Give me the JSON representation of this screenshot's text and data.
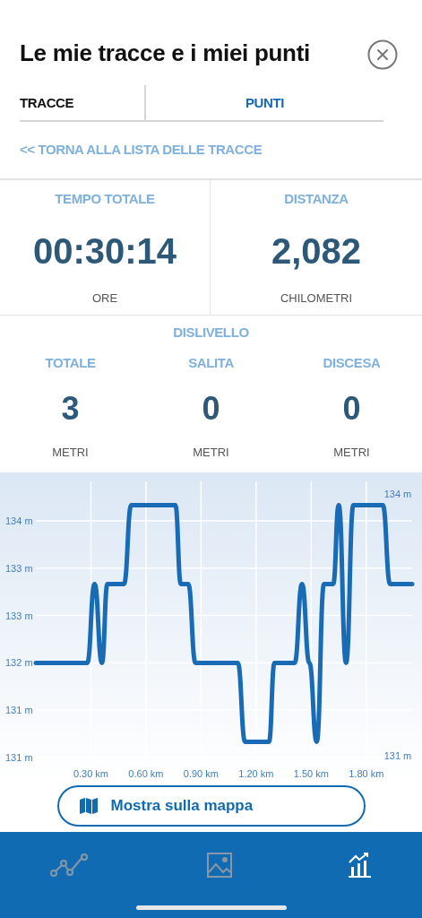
{
  "title": "Le mie tracce e i miei punti",
  "tabs": [
    {
      "label": "TRACCE",
      "selected": true
    },
    {
      "label": "PUNTI",
      "selected": false
    }
  ],
  "back_link": "<< TORNA ALLA LISTA DELLE TRACCE",
  "summary": [
    {
      "label": "TEMPO TOTALE",
      "value": "00:30:14",
      "unit": "ORE"
    },
    {
      "label": "DISTANZA",
      "value": "2,082",
      "unit": "CHILOMETRI"
    }
  ],
  "elevation": {
    "title": "DISLIVELLO",
    "stats": [
      {
        "label": "TOTALE",
        "value": "3",
        "unit": "METRI"
      },
      {
        "label": "SALITA",
        "value": "0",
        "unit": "METRI"
      },
      {
        "label": "DISCESA",
        "value": "0",
        "unit": "METRI"
      }
    ]
  },
  "chart_data": {
    "type": "line",
    "grid": true,
    "xlim": [
      0,
      2.05
    ],
    "ylim": [
      130.8,
      134.3
    ],
    "x": [
      0,
      0.28,
      0.32,
      0.36,
      0.39,
      0.48,
      0.52,
      0.76,
      0.79,
      0.83,
      0.87,
      1.1,
      1.14,
      1.27,
      1.3,
      1.41,
      1.45,
      1.49,
      1.53,
      1.57,
      1.62,
      1.65,
      1.69,
      1.73,
      1.89,
      1.93,
      2.05
    ],
    "series": [
      {
        "color": "#1a6bb5",
        "values": [
          132.0,
          132.0,
          133.0,
          132.0,
          133.0,
          133.0,
          134.0,
          134.0,
          133.0,
          133.0,
          132.0,
          132.0,
          131.0,
          131.0,
          132.0,
          132.0,
          133.0,
          132.0,
          131.0,
          133.0,
          133.0,
          134.0,
          132.0,
          134.0,
          134.0,
          133.0,
          133.0
        ]
      }
    ],
    "xticks": [
      {
        "value": 0.3,
        "label": "0.30 km"
      },
      {
        "value": 0.6,
        "label": "0.60 km"
      },
      {
        "value": 0.9,
        "label": "0.90 km"
      },
      {
        "value": 1.2,
        "label": "1.20 km"
      },
      {
        "value": 1.5,
        "label": "1.50 km"
      },
      {
        "value": 1.8,
        "label": "1.80 km"
      }
    ],
    "yticks": [
      {
        "value": 133.8,
        "label": "134 m"
      },
      {
        "value": 133.2,
        "label": "133 m"
      },
      {
        "value": 132.6,
        "label": "133 m"
      },
      {
        "value": 132.0,
        "label": "132 m"
      },
      {
        "value": 131.4,
        "label": "131 m"
      },
      {
        "value": 130.8,
        "label": "131 m"
      }
    ],
    "annotations": [
      "134 m",
      "131 m"
    ]
  },
  "map_button": "Mostra sulla mappa",
  "nav": [
    {
      "kind": "tracks",
      "selected": false
    },
    {
      "kind": "photos",
      "selected": false
    },
    {
      "kind": "stats",
      "selected": true
    }
  ]
}
